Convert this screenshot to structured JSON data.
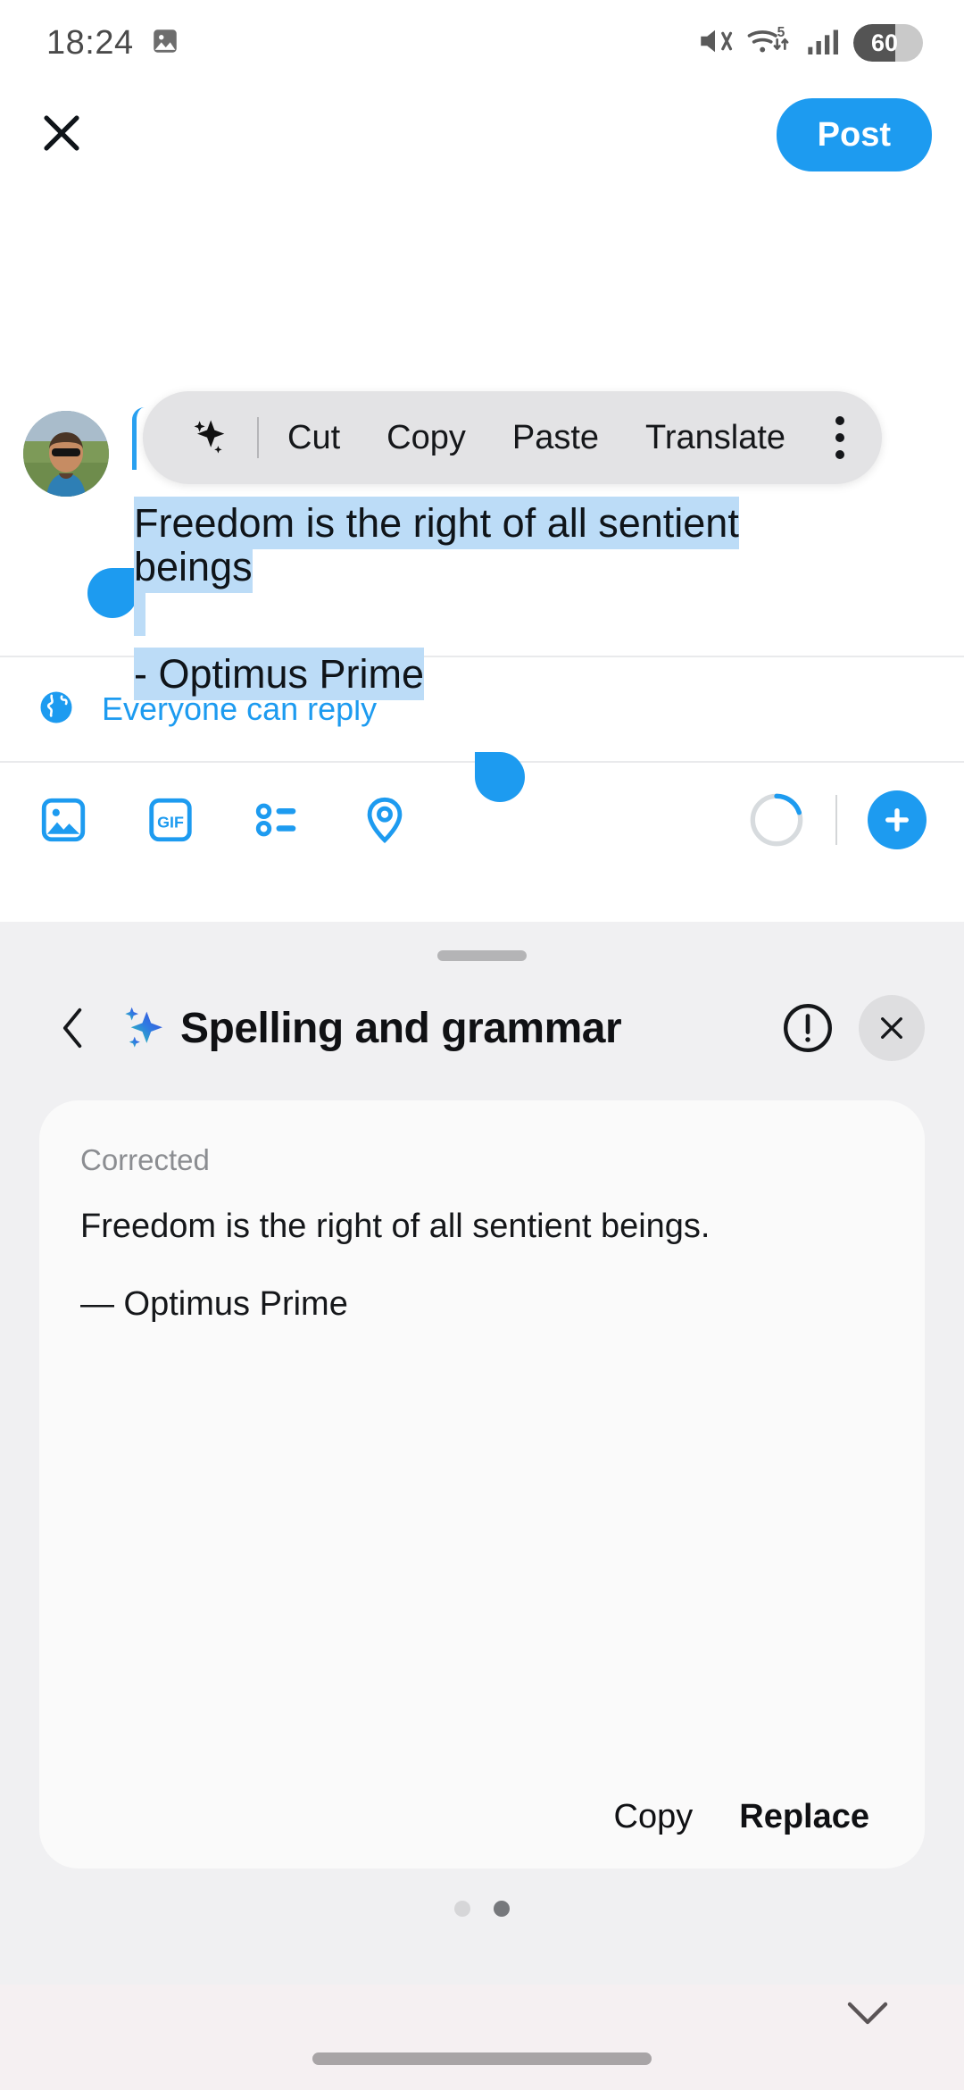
{
  "status_bar": {
    "time": "18:24",
    "left_icons": [
      "image-icon"
    ],
    "right_icons": [
      "mute-icon",
      "wifi-icon",
      "signal-icon"
    ],
    "wifi_label": "5",
    "battery_level": "60"
  },
  "compose": {
    "close_label": "✕",
    "post_label": "Post",
    "tweet_line1": "Freedom is the right of all sentient",
    "tweet_line2": "beings",
    "tweet_line3": "- Optimus Prime",
    "reply_scope": "Everyone can reply",
    "reply_icon": "globe-icon",
    "action_icons": [
      "image-icon",
      "gif-icon",
      "poll-icon",
      "location-icon"
    ],
    "gif_label": "GIF",
    "add_label": "+",
    "char_progress": 20
  },
  "context_menu": {
    "items": [
      "Cut",
      "Copy",
      "Paste",
      "Translate"
    ],
    "sparkle_icon": "sparkle-icon",
    "overflow_icon": "more-vertical-icon"
  },
  "sheet": {
    "title": "Spelling and grammar",
    "title_icon": "sparkle-icon",
    "back_icon": "chevron-left-icon",
    "info_icon": "info-circle-icon",
    "close_icon": "close-icon",
    "corrected_label": "Corrected",
    "corrected_text": "Freedom is the right of all sentient beings.",
    "corrected_attribution": "— Optimus Prime",
    "copy_label": "Copy",
    "replace_label": "Replace",
    "page_dots": 2,
    "active_dot": 1
  },
  "bottom_nav": {
    "dismiss_icon": "chevron-down-icon",
    "home_indicator": "home-indicator"
  },
  "colors": {
    "accent": "#1d9bf0",
    "selection": "#bcdcf7",
    "sheet_bg": "#f0f0f2",
    "card_bg": "#fafafa",
    "nav_bg": "#f5f0f2"
  }
}
